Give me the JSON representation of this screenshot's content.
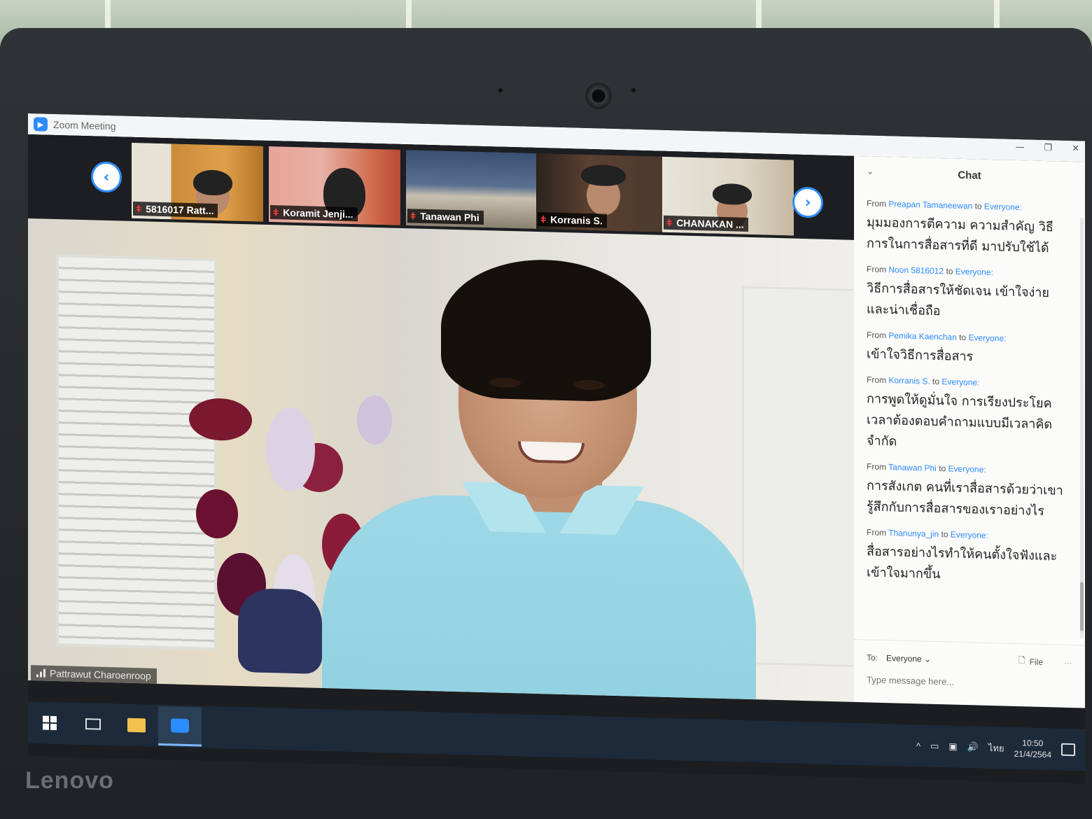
{
  "window": {
    "title": "Zoom Meeting",
    "controls": [
      "—",
      "❐",
      "✕"
    ]
  },
  "participants": [
    {
      "name": "5816017 Ratt..."
    },
    {
      "name": "Koramit Jenji..."
    },
    {
      "name": "Tanawan Phi"
    },
    {
      "name": "Korranis S."
    },
    {
      "name": "CHANAKAN ..."
    }
  ],
  "nav": {
    "prev": "‹",
    "next": "›"
  },
  "speaker": {
    "name": "Pattrawut Charoenroop"
  },
  "chat": {
    "title": "Chat",
    "messages": [
      {
        "from_label": "From",
        "sender": "Preapan Tamaneewan",
        "to_label": "to",
        "recipient": "Everyone:",
        "text": "มุมมองการตีความ ความสำคัญ วิธีการในการสื่อสารที่ดี มาปรับใช้ได้"
      },
      {
        "from_label": "From",
        "sender": "Noon 5816012",
        "to_label": "to",
        "recipient": "Everyone:",
        "text": "วิธีการสื่อสารให้ชัดเจน เข้าใจง่ายและน่าเชื่อถือ"
      },
      {
        "from_label": "From",
        "sender": "Pemika Kaenchan",
        "to_label": "to",
        "recipient": "Everyone:",
        "text": "เข้าใจวิธีการสื่อสาร"
      },
      {
        "from_label": "From",
        "sender": "Korranis S.",
        "to_label": "to",
        "recipient": "Everyone:",
        "text": "การพูดให้ดูมั่นใจ การเรียงประโยค เวลาต้องตอบคำถามแบบมีเวลาคิดจำกัด"
      },
      {
        "from_label": "From",
        "sender": "Tanawan Phi",
        "to_label": "to",
        "recipient": "Everyone:",
        "text": "การสังเกต คนที่เราสื่อสารด้วยว่าเขารู้สึกกับการสื่อสารของเราอย่างไร"
      },
      {
        "from_label": "From",
        "sender": "Thanunya_jin",
        "to_label": "to",
        "recipient": "Everyone:",
        "text": "สื่อสารอย่างไรทำให้คนตั้งใจฟังและเข้าใจมากขึ้น"
      }
    ],
    "to_label": "To:",
    "to_value": "Everyone ⌄",
    "file_label": "File",
    "more_label": "···",
    "input_placeholder": "Type message here..."
  },
  "taskbar": {
    "tray_caret": "^",
    "tray_volume": "🔊",
    "language": "ไทย",
    "time": "10:50",
    "date": "21/4/2564"
  },
  "device": {
    "brand": "Lenovo"
  },
  "colors": {
    "zoom_blue": "#2d8cff",
    "mic_muted": "#ff3b3b",
    "chat_bg": "#fbfbfa",
    "taskbar": "#1c2a3a"
  }
}
